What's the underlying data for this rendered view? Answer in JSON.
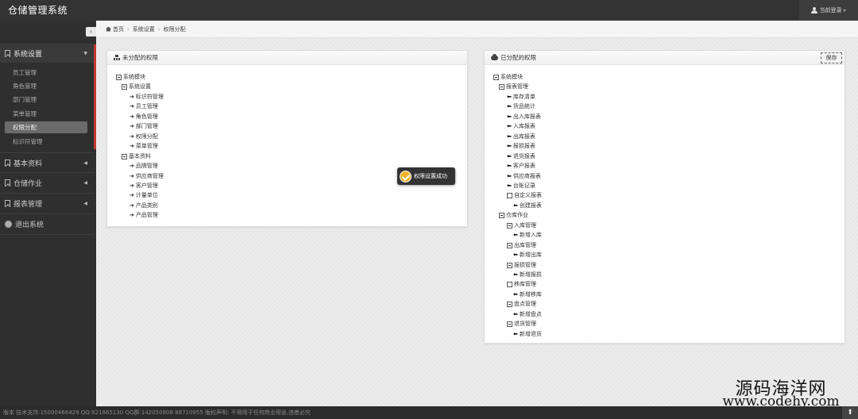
{
  "app": {
    "title": "仓储管理系统"
  },
  "user_menu": {
    "label": "当前登录"
  },
  "sidebar": {
    "collapse_glyph": "‹",
    "groups": [
      {
        "label": "系统设置",
        "items": [
          "员工管理",
          "角色管理",
          "部门管理",
          "菜单管理",
          "权限分配",
          "标识符管理"
        ],
        "active_item": "权限分配"
      },
      {
        "label": "基本资料"
      },
      {
        "label": "仓储作业"
      },
      {
        "label": "报表管理"
      },
      {
        "label": "退出系统"
      }
    ]
  },
  "breadcrumb": {
    "home": "首页",
    "level1": "系统设置",
    "level2": "权限分配"
  },
  "left_panel": {
    "title": "未分配的权限",
    "nodes": [
      {
        "label": "系统模块",
        "type": "folder"
      },
      {
        "label": "系统设置",
        "type": "folder"
      },
      {
        "label": "标识符管理",
        "type": "leaf"
      },
      {
        "label": "员工管理",
        "type": "leaf"
      },
      {
        "label": "角色管理",
        "type": "leaf"
      },
      {
        "label": "部门管理",
        "type": "leaf"
      },
      {
        "label": "权限分配",
        "type": "leaf"
      },
      {
        "label": "菜单管理",
        "type": "leaf"
      },
      {
        "label": "基本资料",
        "type": "folder"
      },
      {
        "label": "品牌管理",
        "type": "leaf"
      },
      {
        "label": "供应商管理",
        "type": "leaf"
      },
      {
        "label": "客户管理",
        "type": "leaf"
      },
      {
        "label": "计量单位",
        "type": "leaf"
      },
      {
        "label": "产品类别",
        "type": "leaf"
      },
      {
        "label": "产品管理",
        "type": "leaf"
      }
    ]
  },
  "right_panel": {
    "title": "已分配的权限",
    "save_label": "保存",
    "nodes": [
      {
        "label": "系统模块",
        "type": "folder"
      },
      {
        "label": "报表管理",
        "type": "folder"
      },
      {
        "label": "库存清单",
        "type": "leaf"
      },
      {
        "label": "货品统计",
        "type": "leaf"
      },
      {
        "label": "出入库报表",
        "type": "leaf"
      },
      {
        "label": "入库报表",
        "type": "leaf"
      },
      {
        "label": "出库报表",
        "type": "leaf"
      },
      {
        "label": "报损报表",
        "type": "leaf"
      },
      {
        "label": "退货报表",
        "type": "leaf"
      },
      {
        "label": "客户报表",
        "type": "leaf"
      },
      {
        "label": "供应商报表",
        "type": "leaf"
      },
      {
        "label": "台账记录",
        "type": "leaf"
      },
      {
        "label": "自定义报表",
        "type": "folder-empty"
      },
      {
        "label": "创建报表",
        "type": "leaf"
      },
      {
        "label": "仓库作业",
        "type": "folder"
      },
      {
        "label": "入库管理",
        "type": "folder"
      },
      {
        "label": "新增入库",
        "type": "leaf"
      },
      {
        "label": "出库管理",
        "type": "folder"
      },
      {
        "label": "新增出库",
        "type": "leaf"
      },
      {
        "label": "报损管理",
        "type": "folder"
      },
      {
        "label": "新增报损",
        "type": "leaf"
      },
      {
        "label": "移库管理",
        "type": "folder-empty"
      },
      {
        "label": "新增移库",
        "type": "leaf"
      },
      {
        "label": "盘点管理",
        "type": "folder"
      },
      {
        "label": "新增盘点",
        "type": "leaf"
      },
      {
        "label": "退货管理",
        "type": "folder"
      },
      {
        "label": "新增退货",
        "type": "leaf"
      }
    ]
  },
  "toast": {
    "message": "权限设置成功"
  },
  "watermark": {
    "line1": "源码海洋网",
    "line2": "www.codehy.com"
  },
  "footer": {
    "text": "版本 技术支持:15000466429 QQ:921865130 QQ群:142050808 88710955 版权声明: 不得用于任何商业用途,违者必究"
  },
  "to_top_glyph": "⬆"
}
